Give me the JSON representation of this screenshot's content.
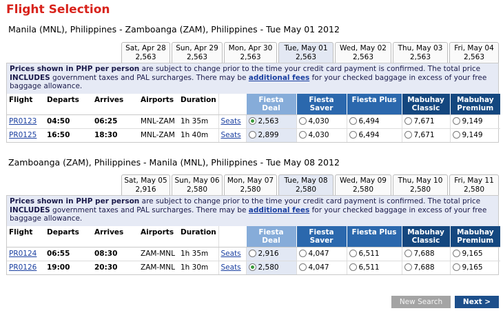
{
  "page_title": "Flight Selection",
  "outbound": {
    "route_title": "Manila (MNL), Philippines - Zamboanga (ZAM), Philippines - Tue May 01 2012",
    "dates": [
      {
        "day": "Sat, Apr 28",
        "price": "2,563"
      },
      {
        "day": "Sun, Apr 29",
        "price": "2,563"
      },
      {
        "day": "Mon, Apr 30",
        "price": "2,563"
      },
      {
        "day": "Tue, May 01",
        "price": "2,563",
        "selected": true
      },
      {
        "day": "Wed, May 02",
        "price": "2,563"
      },
      {
        "day": "Thu, May 03",
        "price": "2,563"
      },
      {
        "day": "Fri, May 04",
        "price": "2,563"
      }
    ],
    "rows": [
      {
        "flight": "PR0123",
        "departs": "04:50",
        "arrives": "06:25",
        "airports": "MNL-ZAM",
        "duration": "1h 35m",
        "seats": "Seats",
        "fares": [
          "2,563",
          "4,030",
          "6,494",
          "7,671",
          "9,149"
        ],
        "selected_fare": 0
      },
      {
        "flight": "PR0125",
        "departs": "16:50",
        "arrives": "18:30",
        "airports": "MNL-ZAM",
        "duration": "1h 40m",
        "seats": "Seats",
        "fares": [
          "2,899",
          "4,030",
          "6,494",
          "7,671",
          "9,149"
        ],
        "selected_fare": -1
      }
    ]
  },
  "return": {
    "route_title": "Zamboanga (ZAM), Philippines - Manila (MNL), Philippines - Tue May 08 2012",
    "dates": [
      {
        "day": "Sat, May 05",
        "price": "2,916"
      },
      {
        "day": "Sun, May 06",
        "price": "2,580"
      },
      {
        "day": "Mon, May 07",
        "price": "2,580"
      },
      {
        "day": "Tue, May 08",
        "price": "2,580",
        "selected": true
      },
      {
        "day": "Wed, May 09",
        "price": "2,580"
      },
      {
        "day": "Thu, May 10",
        "price": "2,580"
      },
      {
        "day": "Fri, May 11",
        "price": "2,580"
      }
    ],
    "rows": [
      {
        "flight": "PR0124",
        "departs": "06:55",
        "arrives": "08:30",
        "airports": "ZAM-MNL",
        "duration": "1h 35m",
        "seats": "Seats",
        "fares": [
          "2,916",
          "4,047",
          "6,511",
          "7,688",
          "9,165"
        ],
        "selected_fare": -1
      },
      {
        "flight": "PR0126",
        "departs": "19:00",
        "arrives": "20:30",
        "airports": "ZAM-MNL",
        "duration": "1h 30m",
        "seats": "Seats",
        "fares": [
          "2,580",
          "4,047",
          "6,511",
          "7,688",
          "9,165"
        ],
        "selected_fare": 0
      }
    ]
  },
  "notice": {
    "bold1": "Prices shown in PHP per person",
    "text1": " are subject to change prior to the time your credit card payment is confirmed. The total price ",
    "bold2": "INCLUDES",
    "text2": " government taxes and PAL surcharges. There may be ",
    "link": "additional fees",
    "text3": " for your checked baggage in excess of your free baggage allowance."
  },
  "columns": {
    "flight": "Flight",
    "departs": "Departs",
    "arrives": "Arrives",
    "airports": "Airports",
    "duration": "Duration",
    "fares": [
      {
        "l1": "Fiesta Deal",
        "l2": ""
      },
      {
        "l1": "Fiesta",
        "l2": "Saver"
      },
      {
        "l1": "Fiesta Plus",
        "l2": ""
      },
      {
        "l1": "Mabuhay",
        "l2": "Classic"
      },
      {
        "l1": "Mabuhay",
        "l2": "Premium"
      }
    ]
  },
  "buttons": {
    "new_search": "New Search",
    "next": "Next >"
  },
  "colors": {
    "title_red": "#d8231c",
    "fare_header": "#2b68ad",
    "fare_header_dark": "#14477f",
    "selected_column": "#86acd9",
    "link": "#1a3fa0"
  }
}
